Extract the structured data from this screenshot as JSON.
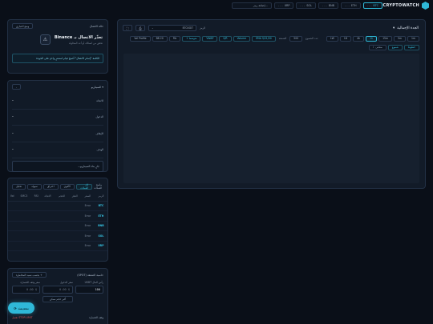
{
  "topbar": {
    "brand": "CRYPTOWATCH",
    "tickers": [
      {
        "symbol": "BTC",
        "value": "- - -",
        "active": true
      },
      {
        "symbol": "ETH",
        "value": "- - -",
        "active": false
      },
      {
        "symbol": "BNB",
        "value": "- - -",
        "active": false
      },
      {
        "symbol": "SOL",
        "value": "- - -",
        "active": false
      },
      {
        "symbol": "XRP",
        "value": "- - -",
        "active": false
      }
    ],
    "search_placeholder": "إضافة رمز..."
  },
  "chart": {
    "title": "الجدة الإجمالية",
    "symbol_label": "الرمز",
    "symbol_value": "BTCUSDT",
    "timeframes_label": "عدد الشموع",
    "timeframes": [
      "1m",
      "5m",
      "15m",
      "1h",
      "4h",
      "1D",
      "1W"
    ],
    "active_timeframe": "1h",
    "candles_select": "500",
    "candles_label": "الشمعة",
    "overlays": [
      "EMA 9/21/50",
      "Volume",
      "S/R",
      "VWAP",
      "BB 20",
      "Fib",
      "Vol Profile"
    ],
    "custom_label": "+ متوسط",
    "view_buttons": [
      "خطوط",
      "شموع",
      "منحنى"
    ],
    "indicator_add": "+ مؤشرات"
  },
  "connection": {
    "header": "حالة الاتصال",
    "mode_pill": "وضع اختباري",
    "title": "تعذّر الاتصال بـ Binance",
    "subtitle": "تحقق من اتصالك أو أعد المحاولة",
    "banner": "الكلمة \"إتمام الاتصال\" أصبحَ قيام لمشترٍ واحدٍ على الجودة"
  },
  "scenario": {
    "header": "السيناريو",
    "pill": "-",
    "rows": [
      {
        "label": "الاتجاه",
        "value": "-"
      },
      {
        "label": "الدخول",
        "value": "-"
      },
      {
        "label": "الإيقاف",
        "value": "-"
      },
      {
        "label": "الهدف",
        "value": "-"
      }
    ],
    "loading": "جارٍ بناء السيناريو..."
  },
  "table": {
    "label": "ماسح العملات",
    "tabs": [
      "تحليل",
      "سيولة",
      "اختراق",
      "الأقوى",
      "كل العملات"
    ],
    "active_tab": "كل العملات",
    "columns": [
      "الرمز",
      "السعر",
      "التغيّر",
      "الحجم",
      "الاتجاه",
      "RSI",
      "SMC3",
      "Vol"
    ],
    "rows": [
      {
        "symbol": "BTC",
        "price": "Error"
      },
      {
        "symbol": "ETH",
        "price": "Error"
      },
      {
        "symbol": "BNB",
        "price": "Error"
      },
      {
        "symbol": "SOL",
        "price": "Error"
      },
      {
        "symbol": "XRP",
        "price": "Error"
      }
    ]
  },
  "trade": {
    "title": "حاسبة الصفقة (SPOT)",
    "mode_select": "+ بحسب نسبة المخاطرة",
    "fields": [
      {
        "label": "رأس المال USDT",
        "value": "100"
      },
      {
        "label": "سعر الدخول",
        "value": "$ 0.00"
      },
      {
        "label": "سعر وقف الخسارة",
        "value": "$ 0.00"
      }
    ],
    "max_button": "أكبر حجم ممكن",
    "alert_a": "STOP-LIMIT تفعيل",
    "alert_b": "وقف الخسارة"
  },
  "refresh_button": "تحديث"
}
